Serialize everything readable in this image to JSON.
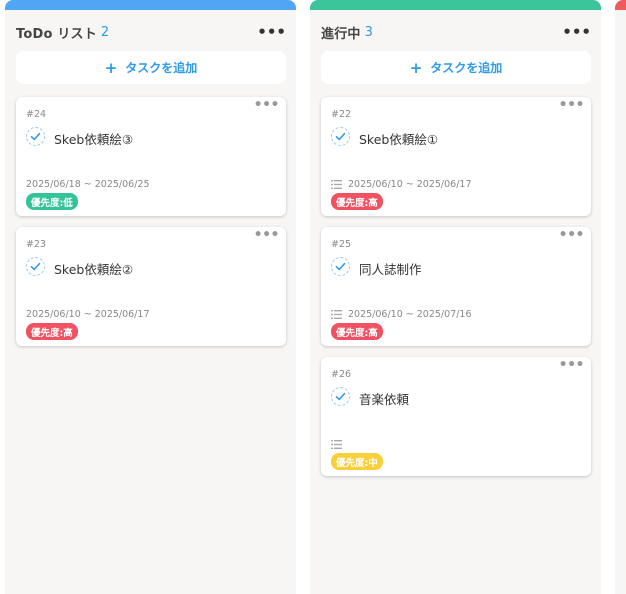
{
  "colors": {
    "todo_bar": "#4ea6f5",
    "progress_bar": "#3cc49a",
    "edge_bar": "#f05a5a",
    "accent": "#2f9ae8",
    "priority_low": "#35c49a",
    "priority_high": "#f05262",
    "priority_mid": "#f8d03a"
  },
  "columns": [
    {
      "title": "ToDo リスト",
      "count": "2",
      "add_label": "タスクを追加",
      "cards": [
        {
          "num": "#24",
          "title": "Skeb依頼絵③",
          "dates": "2025/06/18 ~ 2025/06/25",
          "priority": "優先度:低"
        },
        {
          "num": "#23",
          "title": "Skeb依頼絵②",
          "dates": "2025/06/10 ~ 2025/06/17",
          "priority": "優先度:高"
        }
      ]
    },
    {
      "title": "進行中",
      "count": "3",
      "add_label": "タスクを追加",
      "cards": [
        {
          "num": "#22",
          "title": "Skeb依頼絵①",
          "dates": "2025/06/10 ~ 2025/06/17",
          "priority": "優先度:高"
        },
        {
          "num": "#25",
          "title": "同人誌制作",
          "dates": "2025/06/10 ~ 2025/07/16",
          "priority": "優先度:高"
        },
        {
          "num": "#26",
          "title": "音楽依頼",
          "dates": "",
          "priority": "優先度:中"
        }
      ]
    }
  ],
  "icons": {
    "column_menu": "more-horizontal-icon",
    "card_menu": "more-horizontal-icon",
    "check": "check-circle-icon",
    "subtasks": "list-icon",
    "add": "plus-icon"
  }
}
